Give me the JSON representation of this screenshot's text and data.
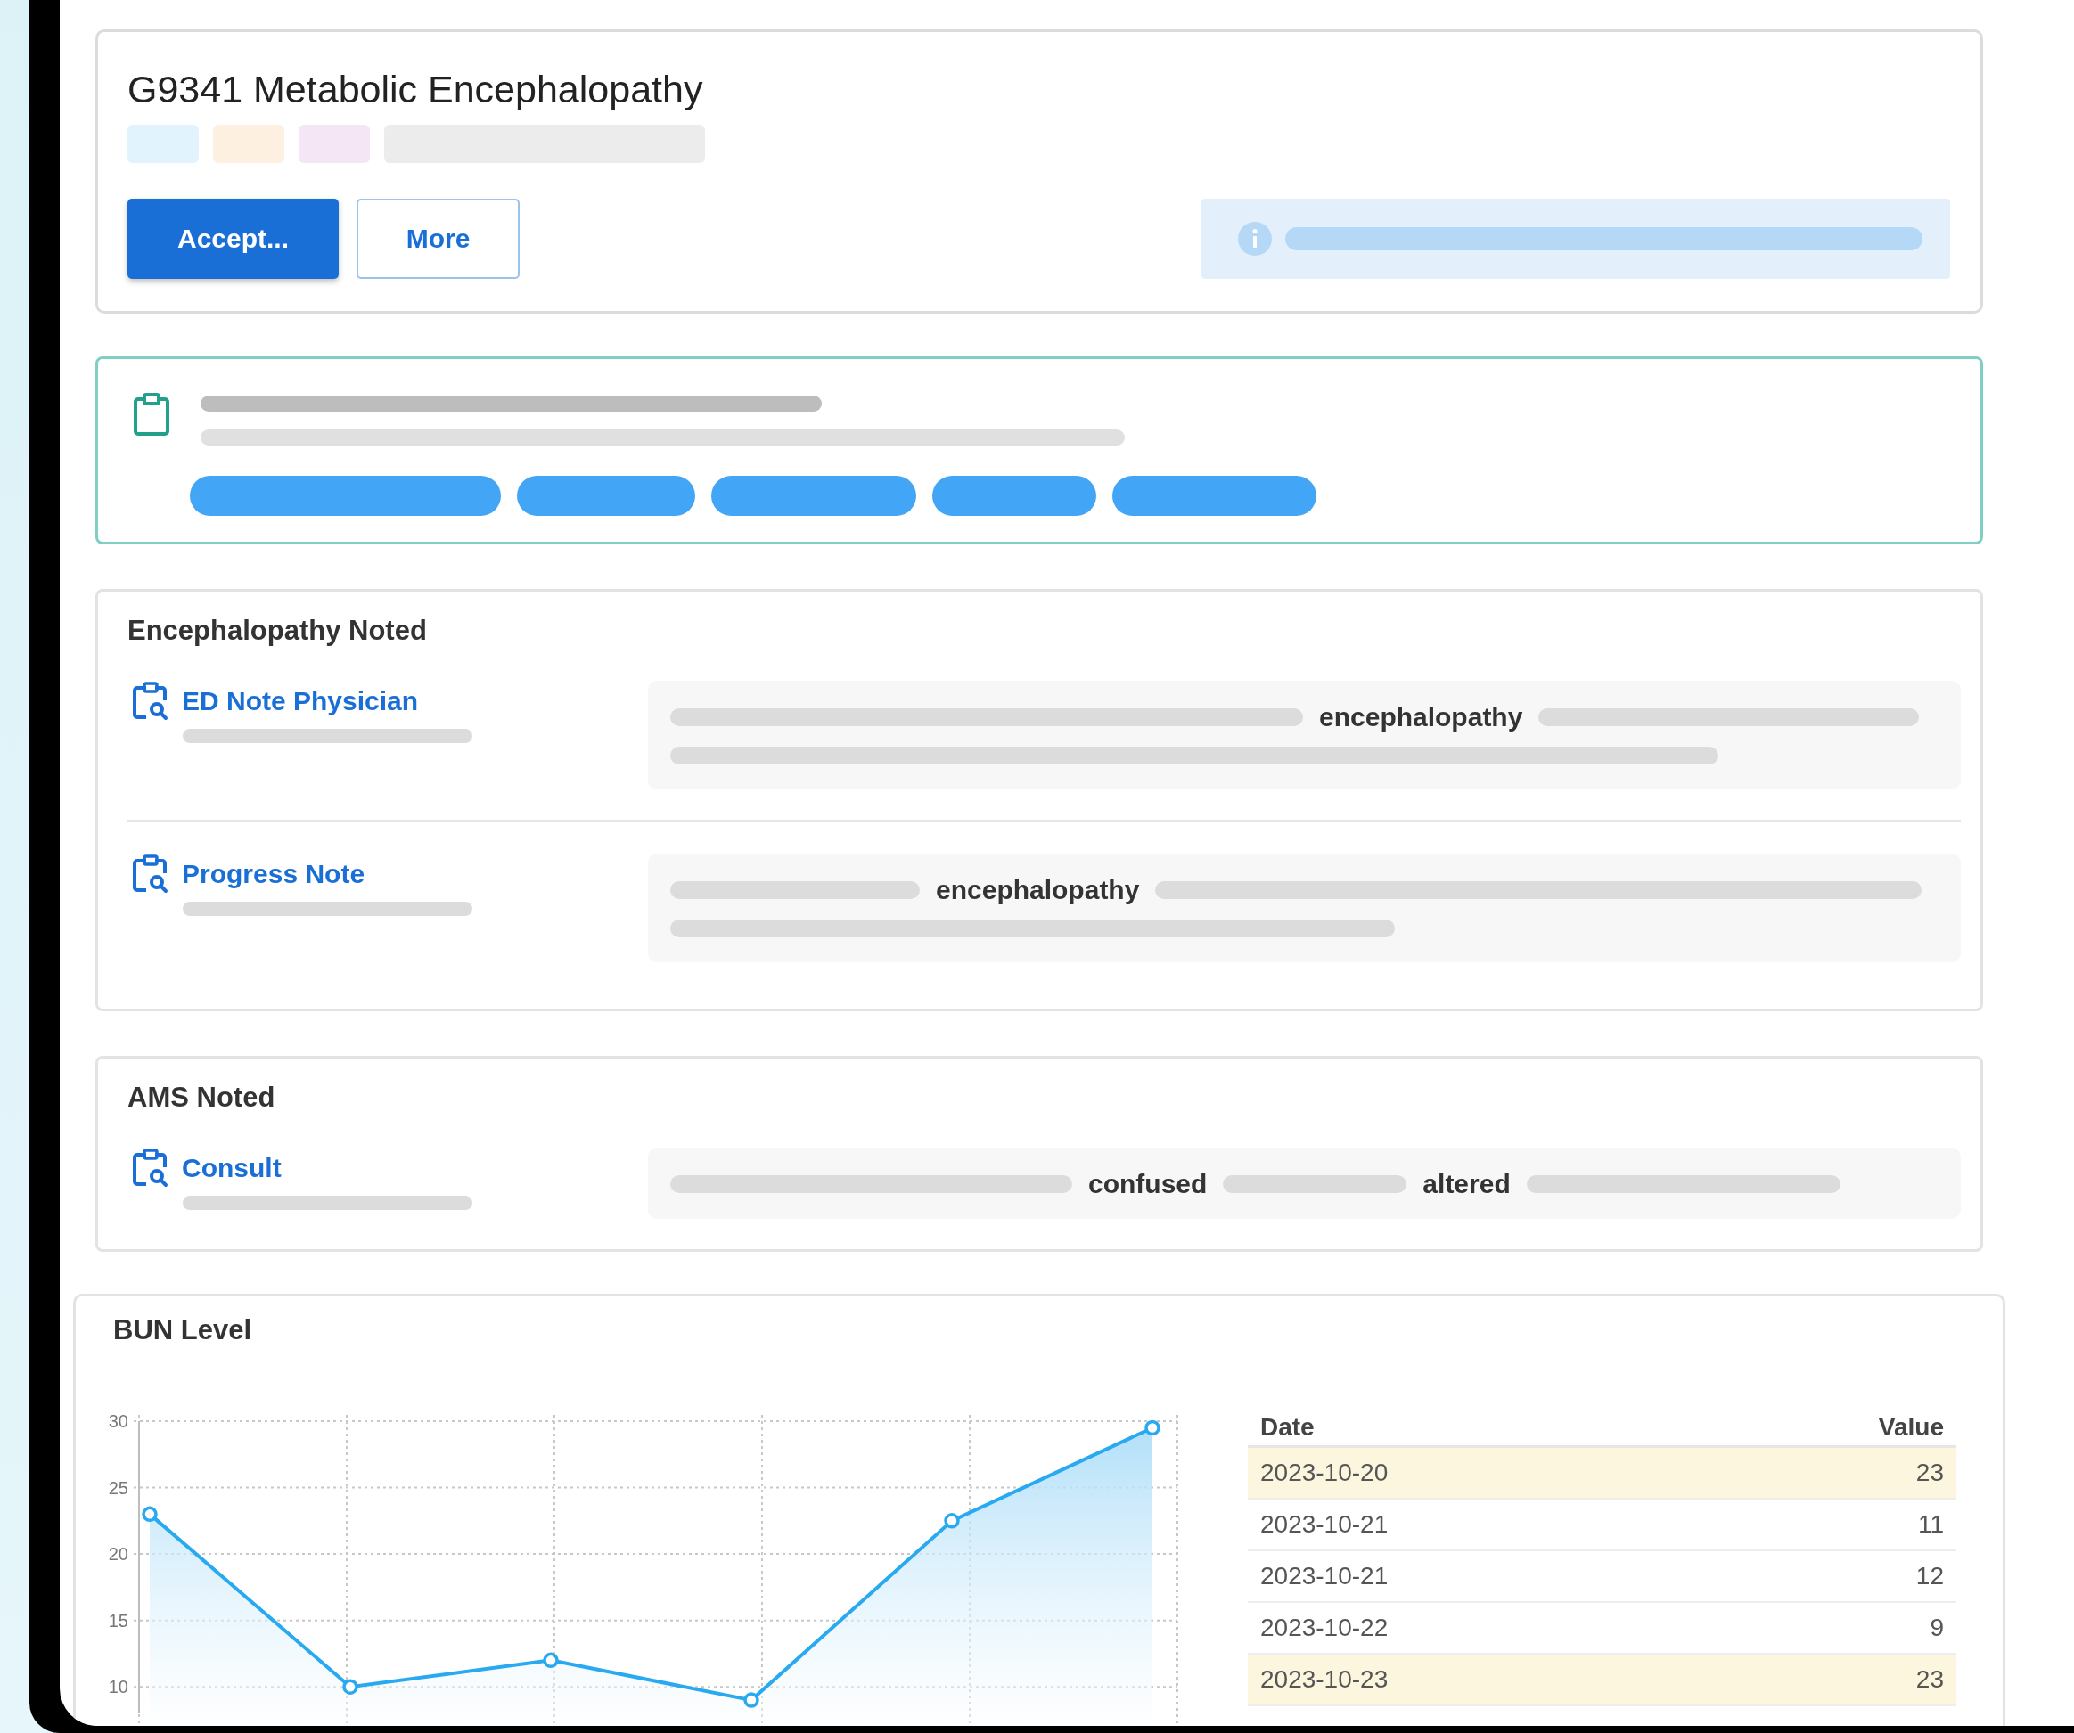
{
  "diagnosis": {
    "title": "G9341 Metabolic Encephalopathy",
    "tags": [
      {
        "color": "#e1f3fd"
      },
      {
        "color": "#fdf0e0"
      },
      {
        "color": "#f5e6f5"
      },
      {
        "color": "#ececec"
      }
    ],
    "buttons": [
      {
        "label": "Accept...",
        "kind": "primary"
      },
      {
        "label": "More",
        "kind": "secondary"
      }
    ]
  },
  "sections": [
    {
      "title": "Encephalopathy Noted",
      "documents": [
        {
          "title": "ED Note Physician",
          "snippet": {
            "kind": "two-line",
            "terms": [
              "encephalopathy"
            ]
          }
        },
        {
          "title": "Progress Note",
          "snippet": {
            "kind": "two-line",
            "terms": [
              "encephalopathy"
            ]
          }
        }
      ]
    },
    {
      "title": "AMS Noted",
      "documents": [
        {
          "title": "Consult",
          "snippet": {
            "kind": "one-line",
            "terms": [
              "confused",
              "altered"
            ]
          }
        }
      ]
    }
  ],
  "bun": {
    "title": "BUN Level",
    "chart_data": {
      "type": "area",
      "categories": [
        null,
        null,
        null,
        null,
        null,
        null
      ],
      "grid": true,
      "ylim": [
        8,
        30
      ],
      "yticks": [
        10,
        15,
        20,
        25,
        30
      ],
      "series": [
        {
          "color": "#29a9f0",
          "values": [
            23,
            10,
            12,
            9,
            22.5,
            29.5
          ]
        }
      ]
    },
    "table": {
      "columns": [
        "Date",
        "Value"
      ],
      "rows": [
        {
          "date": "2023-10-20",
          "value": "23",
          "highlighted": true
        },
        {
          "date": "2023-10-21",
          "value": "11",
          "highlighted": false
        },
        {
          "date": "2023-10-21",
          "value": "12",
          "highlighted": false
        },
        {
          "date": "2023-10-22",
          "value": "9",
          "highlighted": false
        },
        {
          "date": "2023-10-23",
          "value": "23",
          "highlighted": true
        }
      ]
    }
  }
}
